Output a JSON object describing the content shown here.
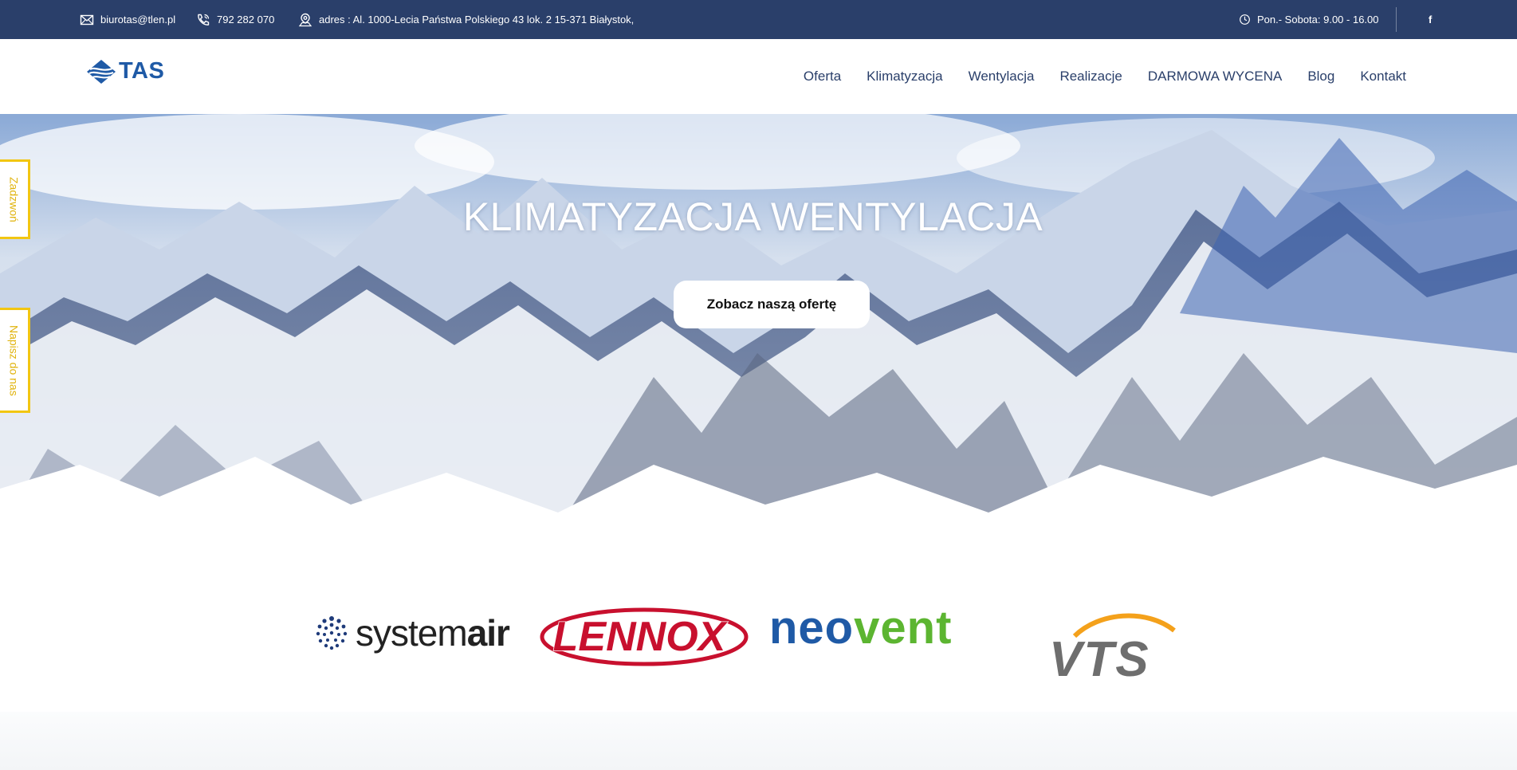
{
  "topbar": {
    "email": "biurotas@tlen.pl",
    "phone": "792 282 070",
    "address": "adres : Al. 1000-Lecia Państwa Polskiego 43 lok. 2 15-371 Białystok,",
    "hours": "Pon.- Sobota: 9.00 - 16.00",
    "social": "f"
  },
  "header": {
    "logo_text": "TAS",
    "nav": [
      "Oferta",
      "Klimatyzacja",
      "Wentylacja",
      "Realizacje",
      "DARMOWA WYCENA",
      "Blog",
      "Kontakt"
    ]
  },
  "hero": {
    "title": "KLIMATYZACJA WENTYLACJA",
    "button": "Zobacz naszą ofertę"
  },
  "side_tabs": {
    "call": "Zadzwoń",
    "write": "Napisz do nas"
  },
  "brands": {
    "systemair_light": "system",
    "systemair_bold": "air",
    "lennox": "LENNOX",
    "neovent_blue": "neo",
    "neovent_green": "vent",
    "vts": "VTS"
  },
  "colors": {
    "topbar_bg": "#2a3f6a",
    "nav_text": "#2a3f6a",
    "accent_yellow": "#f2c612",
    "lennox_red": "#c8102e",
    "neovent_blue": "#1f5aa6",
    "neovent_green": "#5cb531",
    "vts_orange": "#f4a11b",
    "vts_gray": "#6e6e6e"
  },
  "icons": [
    "mail-icon",
    "phone-icon",
    "location-icon",
    "clock-icon",
    "facebook-icon"
  ]
}
